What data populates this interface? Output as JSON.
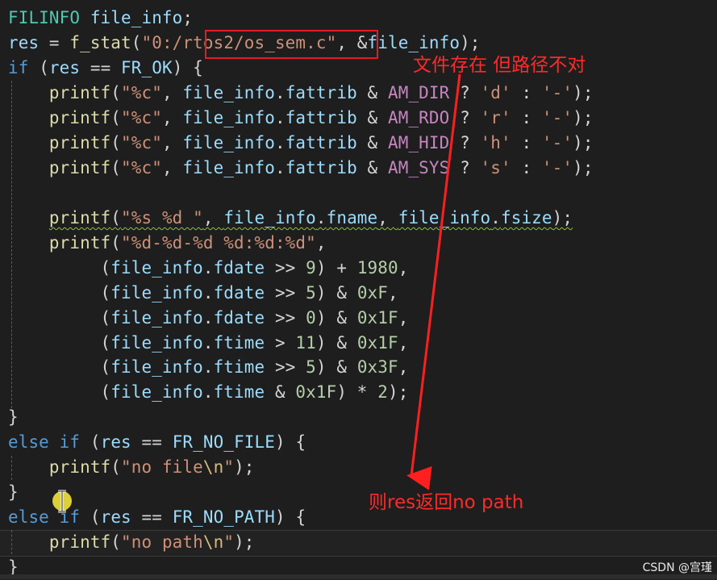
{
  "annotations": {
    "exists_note": "文件存在 但路径不对",
    "return_note": "则res返回no path",
    "color": "#ff2a2a"
  },
  "watermark": "CSDN @宫瑾",
  "code": {
    "l1": {
      "type": "FILINFO",
      "name": "file_info"
    },
    "l2": {
      "var": "res",
      "fn": "f_stat",
      "str_prefix": "\"0:/",
      "path": "rtos2/os_sem.c",
      "str_end": "\"",
      "arg": "file_info"
    },
    "l3": {
      "kw": "if",
      "var": "res",
      "const": "FR_OK"
    },
    "attr_lines": [
      {
        "fn": "printf",
        "fmt": "\"%c\"",
        "obj": "file_info",
        "field": "fattrib",
        "mask": "AM_DIR",
        "ch": "'d'",
        "dash": "'-'"
      },
      {
        "fn": "printf",
        "fmt": "\"%c\"",
        "obj": "file_info",
        "field": "fattrib",
        "mask": "AM_RDO",
        "ch": "'r'",
        "dash": "'-'"
      },
      {
        "fn": "printf",
        "fmt": "\"%c\"",
        "obj": "file_info",
        "field": "fattrib",
        "mask": "AM_HID",
        "ch": "'h'",
        "dash": "'-'"
      },
      {
        "fn": "printf",
        "fmt": "\"%c\"",
        "obj": "file_info",
        "field": "fattrib",
        "mask": "AM_SYS",
        "ch": "'s'",
        "dash": "'-'"
      }
    ],
    "l9": {
      "fn": "printf",
      "fmt": "\"%s %d \"",
      "obj1": "file_info",
      "f1": "fname",
      "obj2": "file_info",
      "f2": "fsize"
    },
    "l10": {
      "fn": "printf",
      "fmt": "\"%d-%d-%d %d:%d:%d\""
    },
    "date_lines": [
      {
        "obj": "file_info",
        "field": "fdate",
        "op": ">>",
        "n": "9",
        "op2": "+",
        "val": "1980",
        "end": ","
      },
      {
        "obj": "file_info",
        "field": "fdate",
        "op": ">>",
        "n": "5",
        "op2": "&",
        "val": "0xF",
        "end": ","
      },
      {
        "obj": "file_info",
        "field": "fdate",
        "op": ">>",
        "n": "0",
        "op2": "&",
        "val": "0x1F",
        "end": ","
      },
      {
        "obj": "file_info",
        "field": "ftime",
        "op": ">",
        "n": "11",
        "op2": "&",
        "val": "0x1F",
        "end": ","
      },
      {
        "obj": "file_info",
        "field": "ftime",
        "op": ">>",
        "n": "5",
        "op2": "&",
        "val": "0x3F",
        "end": ","
      }
    ],
    "l16": {
      "obj": "file_info",
      "field": "ftime",
      "op": "&",
      "val": "0x1F",
      "mul": "*",
      "n": "2"
    },
    "l18": {
      "kw1": "else",
      "kw2": "if",
      "var": "res",
      "const": "FR_NO_FILE"
    },
    "l19": {
      "fn": "printf",
      "str": "\"no file",
      "esc": "\\n",
      "str_end": "\""
    },
    "l21": {
      "kw1": "else",
      "kw2": "if",
      "var": "res",
      "const": "FR_NO_PATH"
    },
    "l22": {
      "fn": "printf",
      "str": "\"no path",
      "esc": "\\n",
      "str_end": "\""
    }
  }
}
